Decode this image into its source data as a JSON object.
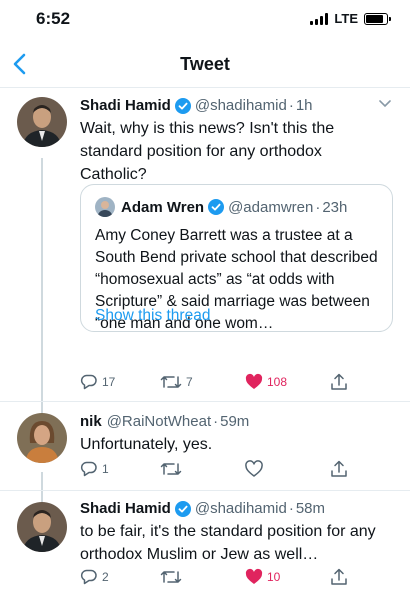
{
  "status_bar": {
    "time": "6:52",
    "network": "LTE"
  },
  "nav": {
    "title": "Tweet"
  },
  "tweets": [
    {
      "name": "Shadi Hamid",
      "handle": "@shadihamid",
      "separator": "·",
      "time": "1h",
      "text": "Wait, why is this news? Isn't this the standard position for any orthodox Catholic?",
      "quote": {
        "name": "Adam Wren",
        "handle": "@adamwren",
        "separator": "·",
        "time": "23h",
        "text": "Amy Coney Barrett was a trustee at a South Bend private school that described “homosexual acts” as “at odds with Scripture” & said marriage was between “one man and one wom…",
        "link": "Show this thread"
      },
      "replies": "17",
      "retweets": "7",
      "likes": "108",
      "liked": true
    },
    {
      "name": "nik",
      "handle": "@RaiNotWheat",
      "separator": "·",
      "time": "59m",
      "text": "Unfortunately, yes.",
      "replies": "1",
      "retweets": "",
      "likes": "",
      "liked": false
    },
    {
      "name": "Shadi Hamid",
      "handle": "@shadihamid",
      "separator": "·",
      "time": "58m",
      "text": "to be fair, it's the standard position for any orthodox Muslim or Jew as well…",
      "replies": "2",
      "retweets": "",
      "likes": "10",
      "liked": true
    }
  ],
  "colors": {
    "accent": "#1d9bf0",
    "like": "#e0245e",
    "muted": "#536471"
  },
  "icons": [
    "back-chevron-icon",
    "verified-badge-icon",
    "reply-icon",
    "retweet-icon",
    "heart-icon",
    "share-icon",
    "caret-down-icon"
  ]
}
